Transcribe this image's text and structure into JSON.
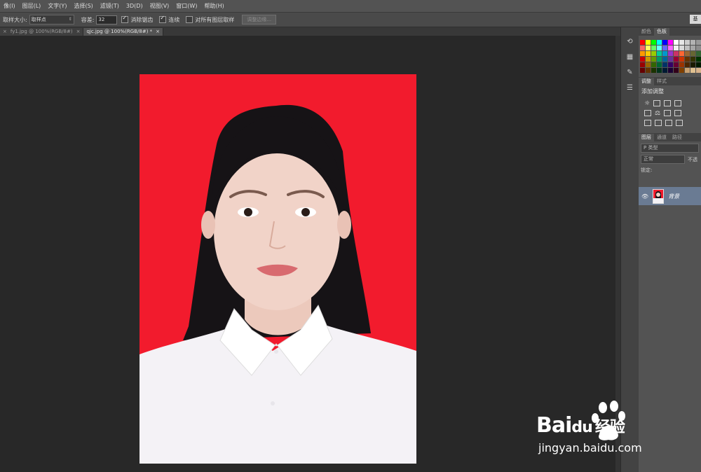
{
  "menu": [
    "像(I)",
    "图层(L)",
    "文字(Y)",
    "选择(S)",
    "滤镜(T)",
    "3D(D)",
    "视图(V)",
    "窗口(W)",
    "帮助(H)"
  ],
  "options": {
    "sample_size_label": "取样大小:",
    "sample_size_value": "取样点",
    "tolerance_label": "容差:",
    "tolerance_value": "32",
    "antialias_label": "消除锯齿",
    "contiguous_label": "连续",
    "all_layers_label": "对所有图层取样",
    "refine_edge_label": "调整边缘...",
    "right_button": "基"
  },
  "tabs": [
    {
      "close": "×",
      "label": "fy1.jpg @ 100%(RGB/8#)",
      "close2": "×"
    },
    {
      "label": "qjc.jpg @ 100%(RGB/8#) *",
      "close2": "×"
    }
  ],
  "panels": {
    "color_tabs": [
      "颜色",
      "色板"
    ],
    "adjust_tabs": [
      "调整",
      "样式"
    ],
    "adjust_title": "添加调整",
    "layer_tabs": [
      "图层",
      "通道",
      "路径"
    ],
    "layer_filter": "P 类型",
    "blend_mode": "正常",
    "opacity_label": "不透",
    "lock_label": "锁定:",
    "layer_name": "背景"
  },
  "watermark": {
    "brand": "Bai",
    "brand2": "du",
    "cn": "经验",
    "url": "jingyan.baidu.com"
  },
  "colors": {
    "photo_background": "#f21b2d",
    "shirt": "#f4f2f6",
    "hair": "#161316",
    "skin": "#f1d3c8",
    "layer_selected": "#6a7b93"
  },
  "swatches": [
    "#ff0000",
    "#ffff00",
    "#00ff00",
    "#00ffff",
    "#0000ff",
    "#ff00ff",
    "#ffffff",
    "#e6e6e6",
    "#cccccc",
    "#b3b3b3",
    "#999999",
    "#ff6666",
    "#ffff66",
    "#66ff66",
    "#66ffff",
    "#6666ff",
    "#ff66ff",
    "#f0f0f0",
    "#d9d9d9",
    "#bfbfbf",
    "#a6a6a6",
    "#8c8c8c",
    "#ff9900",
    "#ffcc00",
    "#99cc00",
    "#00cc99",
    "#0099cc",
    "#9933cc",
    "#cc3366",
    "#ff6633",
    "#996633",
    "#666633",
    "#336633",
    "#cc0000",
    "#cc9900",
    "#669900",
    "#009966",
    "#006699",
    "#663399",
    "#990033",
    "#cc3300",
    "#663300",
    "#333300",
    "#003300",
    "#990000",
    "#996600",
    "#336600",
    "#006633",
    "#003366",
    "#330066",
    "#660033",
    "#993300",
    "#4d2600",
    "#1a1a00",
    "#001a00",
    "#660000",
    "#663300",
    "#1a3300",
    "#00331a",
    "#001a33",
    "#1a0033",
    "#33001a",
    "#804000",
    "#c8a070",
    "#e0c090",
    "#d9b38c"
  ]
}
